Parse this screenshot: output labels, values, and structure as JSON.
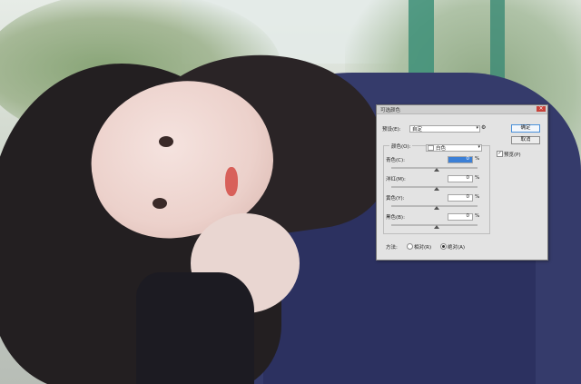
{
  "dialog": {
    "title": "可选颜色",
    "close_glyph": "×",
    "preset_label": "预设(E):",
    "preset_value": "自定",
    "colors_label": "颜色(O):",
    "colors_value": "白色",
    "sliders": [
      {
        "label": "青色(C):",
        "value": "0"
      },
      {
        "label": "洋红(M):",
        "value": "0"
      },
      {
        "label": "黄色(Y):",
        "value": "0"
      },
      {
        "label": "黑色(B):",
        "value": "0"
      }
    ],
    "percent": "%",
    "method_label": "方法:",
    "method_relative": "相对(R)",
    "method_absolute": "绝对(A)",
    "ok_label": "确定",
    "cancel_label": "取消",
    "preview_label": "预览(P)",
    "preview_checked": true
  }
}
